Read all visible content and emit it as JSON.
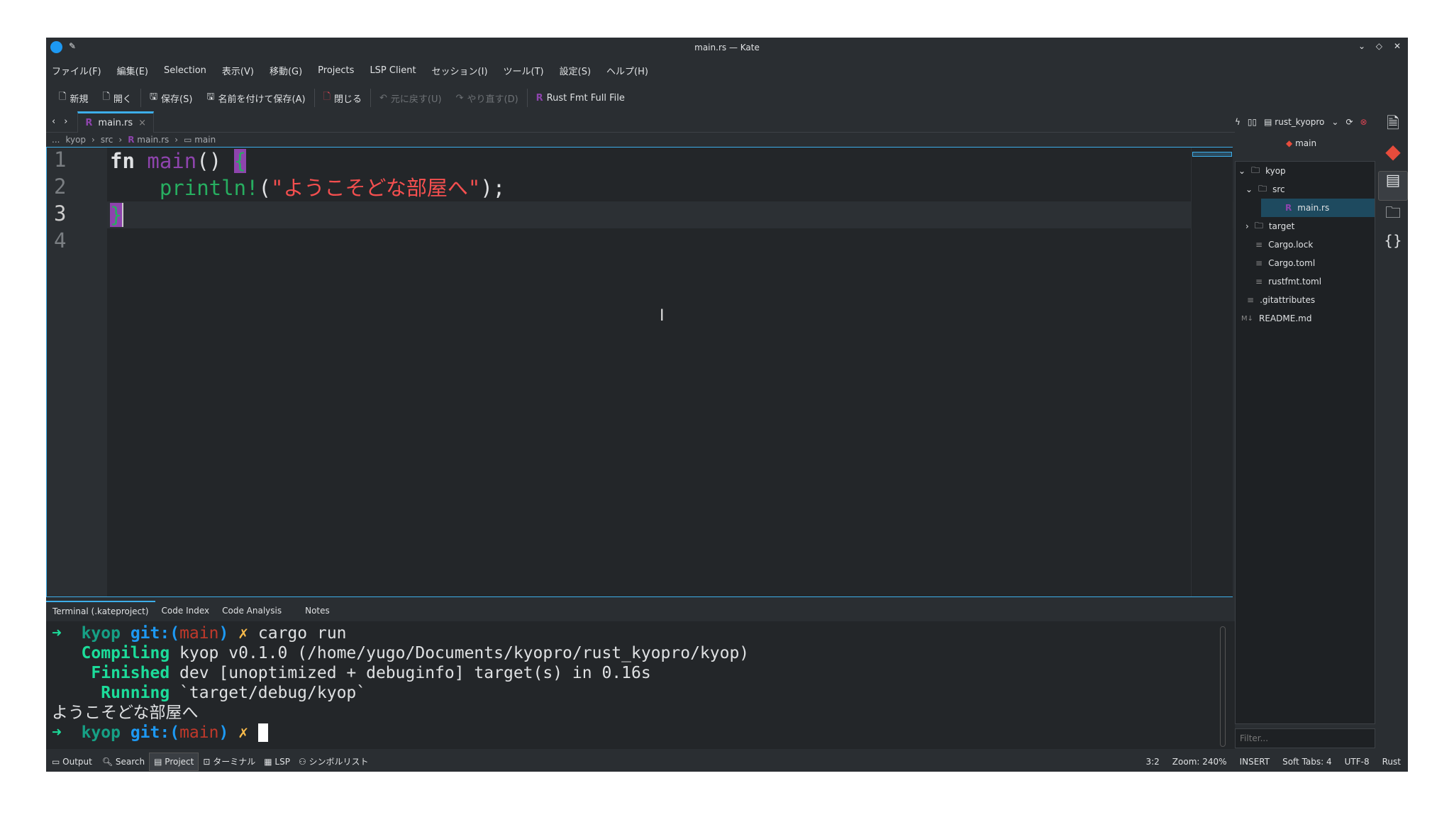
{
  "window": {
    "title": "main.rs — Kate"
  },
  "menu": [
    "ファイル(F)",
    "編集(E)",
    "Selection",
    "表示(V)",
    "移動(G)",
    "Projects",
    "LSP Client",
    "セッション(I)",
    "ツール(T)",
    "設定(S)",
    "ヘルプ(H)"
  ],
  "toolbar": {
    "new": "新規",
    "open": "開く",
    "save": "保存(S)",
    "save_as": "名前を付けて保存(A)",
    "close": "閉じる",
    "undo": "元に戻す(U)",
    "redo": "やり直す(D)",
    "rustfmt": "Rust Fmt Full File"
  },
  "tab": {
    "label": "main.rs"
  },
  "breadcrumb": [
    "...",
    "kyop",
    "src",
    "main.rs",
    "main"
  ],
  "editor": {
    "lines": [
      "1",
      "2",
      "3",
      "4"
    ],
    "kw": "fn",
    "fname": "main",
    "parens": "() ",
    "lbrace": "{",
    "macro": "println!",
    "open": "(",
    "str": "\"ようこそどな部屋へ\"",
    "close": ");",
    "rbrace": "}"
  },
  "project": {
    "name": "rust_kyopro",
    "branch": "main",
    "filter_placeholder": "Filter...",
    "tree": [
      {
        "label": "kyop",
        "type": "folder",
        "level": 0,
        "open": true
      },
      {
        "label": "src",
        "type": "folder",
        "level": 1,
        "open": true
      },
      {
        "label": "main.rs",
        "type": "rust",
        "level": 2,
        "selected": true
      },
      {
        "label": "target",
        "type": "folder",
        "level": 1
      },
      {
        "label": "Cargo.lock",
        "type": "file",
        "level": 1
      },
      {
        "label": "Cargo.toml",
        "type": "file",
        "level": 1
      },
      {
        "label": "rustfmt.toml",
        "type": "file",
        "level": 1
      },
      {
        "label": ".gitattributes",
        "type": "file",
        "level": 0
      },
      {
        "label": "README.md",
        "type": "md",
        "level": 0
      }
    ]
  },
  "bottom_tabs": [
    "Terminal (.kateproject)",
    "Code Index",
    "Code Analysis",
    "Notes"
  ],
  "terminal": {
    "arrow": "➜",
    "dir": "kyop",
    "git": "git:(",
    "branch": "main",
    "gitclose": ")",
    "x": "✗",
    "cmd": "cargo run",
    "l2a": "   Compiling",
    "l2b": " kyop v0.1.0 (/home/yugo/Documents/kyopro/rust_kyopro/kyop)",
    "l3a": "    Finished",
    "l3b": " dev [unoptimized + debuginfo] target(s) in 0.16s",
    "l4a": "     Running",
    "l4b": " `target/debug/kyop`",
    "out": "ようこそどな部屋へ"
  },
  "status": {
    "tabs": [
      "Output",
      "Search",
      "Project",
      "ターミナル",
      "LSP",
      "シンボルリスト"
    ],
    "cursor": "3:2",
    "zoom": "Zoom: 240%",
    "mode": "INSERT",
    "indent": "Soft Tabs: 4",
    "encoding": "UTF-8",
    "lang": "Rust"
  },
  "colors": {
    "accent": "#3daee9",
    "rust": "#8e44ad",
    "string": "#f44f4f",
    "macro": "#27ae60",
    "git": "#e74c3c"
  }
}
